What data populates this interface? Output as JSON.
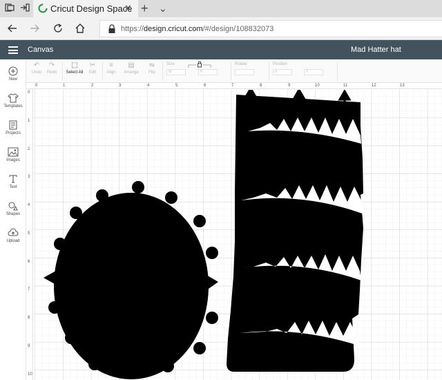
{
  "browser": {
    "tab_title": "Cricut Design Space",
    "tab_close": "✕",
    "new_tab": "+",
    "tab_menu": "⌄",
    "url_prefix": "https://",
    "url_host": "design.cricut.com",
    "url_path": "/#/design/108832073"
  },
  "app": {
    "title": "Canvas",
    "project_name": "Mad Hatter hat"
  },
  "toolbar": {
    "undo": "Undo",
    "redo": "Redo",
    "select_all": "Select All",
    "edit": "Edit",
    "align": "Align",
    "arrange": "Arrange",
    "flip": "Flip",
    "size": "Size",
    "size_w": "W",
    "size_h": "H",
    "rotate": "Rotate",
    "position": "Position",
    "position_x": "X",
    "position_y": "Y"
  },
  "left_panel": {
    "items": [
      {
        "label": "New",
        "icon": "plus-circle-icon"
      },
      {
        "label": "Templates",
        "icon": "tshirt-icon"
      },
      {
        "label": "Projects",
        "icon": "projects-icon"
      },
      {
        "label": "Images",
        "icon": "image-icon"
      },
      {
        "label": "Text",
        "icon": "text-icon"
      },
      {
        "label": "Shapes",
        "icon": "shapes-icon"
      },
      {
        "label": "Upload",
        "icon": "upload-cloud-icon"
      }
    ]
  },
  "rulers": {
    "top": [
      "0",
      "1",
      "2",
      "3",
      "4",
      "5",
      "6",
      "7",
      "8",
      "9",
      "10",
      "11",
      "12",
      "13"
    ],
    "left": [
      "0",
      "1",
      "2",
      "3",
      "4",
      "5",
      "6",
      "7",
      "8",
      "9",
      "10"
    ]
  },
  "colors": {
    "header": "#43535e",
    "shape": "#000000",
    "grid_major": "#d4d4d4",
    "grid_minor": "#ececec"
  }
}
